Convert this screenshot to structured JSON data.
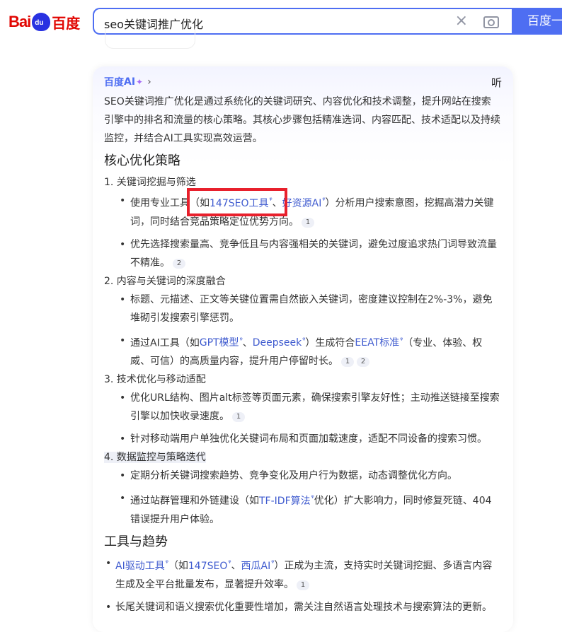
{
  "logo": {
    "bai": "Bai",
    "du": "du",
    "cn": "百度"
  },
  "search": {
    "query": "seo关键词推广优化",
    "clear_icon": "close-icon",
    "camera_icon": "camera-icon",
    "button": "百度一下"
  },
  "ai": {
    "brand": "百度",
    "brand_ai": "AI",
    "chevron": "›",
    "listen": "听",
    "intro": "SEO关键词推广优化是通过系统化的关键词研究、内容优化和技术调整，提升网站在搜索引擎中的排名和流量的核心策略。其核心步骤包括精准选词、内容匹配、技术适配以及持续监控，并结合AI工具实现高效运营。",
    "h1": "核心优化策略",
    "s1": {
      "title": "1. 关键词挖掘与筛选",
      "b1": {
        "pre": "使用专业工具（如",
        "l1": "147SEO工具",
        "sep": "、",
        "l2": "好资源AI",
        "post": "）分析用户搜索意图，挖掘高潜力关键词，同时结合竞品策略定位优势方向。",
        "c": "1"
      },
      "b2": {
        "text": "优先选择搜索量高、竞争低且与内容强相关的关键词，避免过度追求热门词导致流量不精准。",
        "c": "2"
      }
    },
    "s2": {
      "title": "2. 内容与关键词的深度融合",
      "b1": {
        "text": "标题、元描述、正文等关键位置需自然嵌入关键词，密度建议控制在2%-3%，避免堆砌引发搜索引擎惩罚。"
      },
      "b2": {
        "pre": "通过AI工具（如",
        "l1": "GPT模型",
        "sep": "、",
        "l2": "Deepseek",
        "mid": "）生成符合",
        "l3": "EEAT标准",
        "post": "（专业、体验、权威、可信）的高质量内容，提升用户停留时长。",
        "c1": "1",
        "c2": "2"
      }
    },
    "s3": {
      "title": "3. 技术优化与移动适配",
      "b1": {
        "text": "优化URL结构、图片alt标签等页面元素，确保搜索引擎友好性；主动推送链接至搜索引擎以加快收录速度。",
        "c": "1"
      },
      "b2": {
        "text": "针对移动端用户单独优化关键词布局和页面加载速度，适配不同设备的搜索习惯。"
      }
    },
    "s4": {
      "title": "4. 数据监控与策略迭代",
      "b1": {
        "text": "定期分析关键词搜索趋势、竞争变化及用户行为数据，动态调整优化方向。"
      },
      "b2": {
        "pre": "通过站群管理和外链建设（如",
        "l1": "TF-IDF算法",
        "post": "优化）扩大影响力，同时修复死链、404错误提升用户体验。"
      }
    },
    "h2": "工具与趋势",
    "t1": {
      "l1": "AI驱动工具",
      "pre": "（如",
      "l2": "147SEO",
      "sep": "、",
      "l3": "西瓜AI",
      "post": "）正成为主流，支持实时关键词挖掘、多语言内容生成及全平台批量发布，显著提升效率。",
      "c": "1"
    },
    "t2": {
      "text": "长尾关键词和语义搜索优化重要性增加，需关注自然语言处理技术与搜索算法的更新。"
    }
  }
}
